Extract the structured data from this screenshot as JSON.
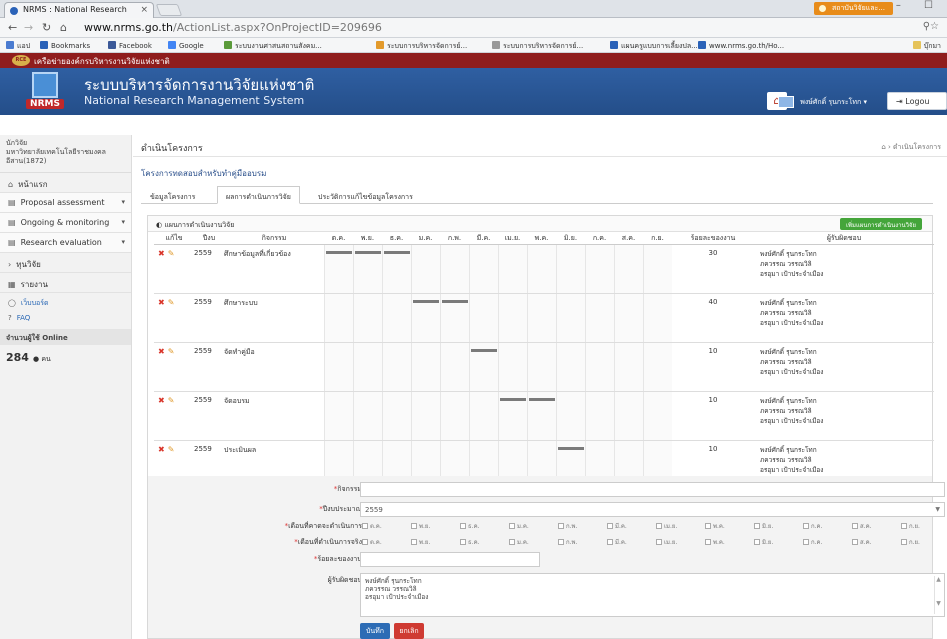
{
  "browser": {
    "tab_title": "NRMS : National Research",
    "tab_close": "×",
    "user_chip": "สถาบันวิจัยและ...",
    "window_controls": "– ☐",
    "url_domain": "www.nrms.go.th",
    "url_path": "/ActionList.aspx?OnProjectID=209696",
    "bookmarks": [
      {
        "label": "แอป",
        "color": "#4a7bd0"
      },
      {
        "label": "Bookmarks",
        "color": "#2a62b8"
      },
      {
        "label": "Facebook",
        "color": "#3b5998"
      },
      {
        "label": "Google",
        "color": "#4285f4"
      },
      {
        "label": "ระบบงานศาสนสถานสังคม...",
        "color": "#5a9a3a"
      },
      {
        "label": "ระบบการบริหารจัดการย์...",
        "color": "#e39a2b"
      },
      {
        "label": "ระบบการบริหารจัดการย์...",
        "color": "#999999"
      },
      {
        "label": "แผนครูแบบการเลี้ยงปล...",
        "color": "#2a62b8"
      },
      {
        "label": "www.nrms.go.th/Ho...",
        "color": "#2a62b8"
      }
    ],
    "bookmarks_folder": "บุ๊กมา"
  },
  "header": {
    "network_name": "เครือข่ายองค์กรบริหารงานวิจัยแห่งชาติ",
    "logo_short": "NRMS",
    "title_th": "ระบบบริหารจัดการงานวิจัยแห่งชาติ",
    "title_en": "National Research Management System",
    "user_name": "พงษ์ศักดิ์ รุนกระโทก ▾",
    "logout": "Logou"
  },
  "sidebar": {
    "user_role": "นักวิจัย",
    "user_org": "มหาวิทยาลัยเทคโนโลยีราชมงคลอีสาน(1872)",
    "items": [
      {
        "label": "หน้าแรก",
        "icon": "⌂"
      },
      {
        "label": "Proposal assessment",
        "icon": "▤",
        "chev": "▾"
      },
      {
        "label": "Ongoing & monitoring",
        "icon": "▤",
        "chev": "▾"
      },
      {
        "label": "Research evaluation",
        "icon": "▤",
        "chev": "▾"
      },
      {
        "label": "ทุนวิจัย",
        "icon": "›"
      },
      {
        "label": "รายงาน",
        "icon": "▦"
      }
    ],
    "webboard": "เว็บบอร์ด",
    "faq": "FAQ",
    "online_header": "จำนวนผู้ใช้ Online",
    "online_count": "284",
    "online_unit": "คน"
  },
  "main": {
    "page_title": "ดำเนินโครงการ",
    "breadcrumb": "⌂ ›  ดำเนินโครงการ",
    "project_title": "โครงการทดสอบสำหรับทำคู่มืออบรม",
    "tabs": [
      "ข้อมูลโครงการ",
      "ผลการดำเนินการวิจัย",
      "ประวัติการแก้ไขข้อมูลโครงการ"
    ],
    "panel_title": "แผนการดำเนินงานวิจัย",
    "add_button": "เพิ่มแผนการดำเนินงานวิจัย",
    "columns": {
      "edit": "แก้ไข",
      "year": "ปีงบ",
      "activity": "กิจกรรม",
      "percent": "ร้อยละของงาน",
      "responsible": "ผู้รับผิดชอบ"
    },
    "months": [
      "ต.ค.",
      "พ.ย.",
      "ธ.ค.",
      "ม.ค.",
      "ก.พ.",
      "มี.ค.",
      "เม.ย.",
      "พ.ค.",
      "มิ.ย.",
      "ก.ค.",
      "ส.ค.",
      "ก.ย."
    ],
    "rows": [
      {
        "year": "2559",
        "activity": "ศึกษาข้อมูลที่เกี่ยวข้อง",
        "months": [
          1,
          1,
          1,
          0,
          0,
          0,
          0,
          0,
          0,
          0,
          0,
          0
        ],
        "percent": "30",
        "people": [
          "พงษ์ศักดิ์ รุนกระโทก",
          "ภควรรณ วรรณวิลิ",
          "อรอุมา เป้าประจำเมือง"
        ]
      },
      {
        "year": "2559",
        "activity": "ศึกษาระบบ",
        "months": [
          0,
          0,
          0,
          1,
          1,
          0,
          0,
          0,
          0,
          0,
          0,
          0
        ],
        "percent": "40",
        "people": [
          "พงษ์ศักดิ์ รุนกระโทก",
          "ภควรรณ วรรณวิลิ",
          "อรอุมา เป้าประจำเมือง"
        ]
      },
      {
        "year": "2559",
        "activity": "จัดทำคู่มือ",
        "months": [
          0,
          0,
          0,
          0,
          0,
          1,
          0,
          0,
          0,
          0,
          0,
          0
        ],
        "percent": "10",
        "people": [
          "พงษ์ศักดิ์ รุนกระโทก",
          "ภควรรณ วรรณวิลิ",
          "อรอุมา เป้าประจำเมือง"
        ]
      },
      {
        "year": "2559",
        "activity": "จัดอบรม",
        "months": [
          0,
          0,
          0,
          0,
          0,
          0,
          1,
          1,
          0,
          0,
          0,
          0
        ],
        "percent": "10",
        "people": [
          "พงษ์ศักดิ์ รุนกระโทก",
          "ภควรรณ วรรณวิลิ",
          "อรอุมา เป้าประจำเมือง"
        ]
      },
      {
        "year": "2559",
        "activity": "ประเมินผล",
        "months": [
          0,
          0,
          0,
          0,
          0,
          0,
          0,
          0,
          1,
          0,
          0,
          0
        ],
        "percent": "10",
        "people": [
          "พงษ์ศักดิ์ รุนกระโทก",
          "ภควรรณ วรรณวิลิ",
          "อรอุมา เป้าประจำเมือง"
        ]
      }
    ],
    "form": {
      "activity_label": "กิจกรรม",
      "year_label": "ปีงบประมาณ",
      "year_value": "2559",
      "plan_months_label": "เดือนที่คาดจะดำเนินการ",
      "actual_months_label": "เดือนที่ดำเนินการจริง",
      "percent_label": "ร้อยละของงาน",
      "responsible_label": "ผู้รับผิดชอบ",
      "responsible_lines": [
        "พงษ์ศักดิ์ รุนกระโทก",
        "ภควรรณ วรรณวิลิ",
        "อรอุมา เป้าประจำเมือง"
      ],
      "save": "บันทึก",
      "cancel": "ยกเลิก"
    }
  }
}
